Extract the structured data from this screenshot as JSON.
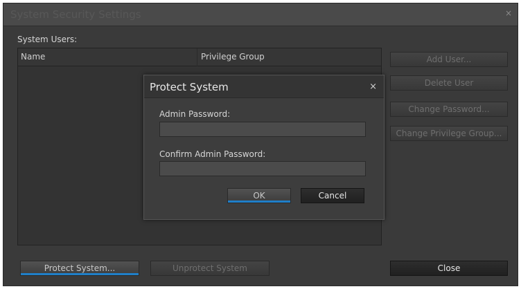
{
  "window": {
    "title": "System Security Settings",
    "close_glyph": "×"
  },
  "users_section": {
    "label": "System Users:",
    "columns": [
      "Name",
      "Privilege Group"
    ],
    "rows": []
  },
  "side_buttons": {
    "add_user": "Add User...",
    "delete_user": "Delete User",
    "change_password": "Change Password...",
    "change_privilege_group": "Change Privilege Group..."
  },
  "bottom_buttons": {
    "protect_system": "Protect System...",
    "unprotect_system": "Unprotect System",
    "close": "Close"
  },
  "dialog": {
    "title": "Protect System",
    "close_glyph": "×",
    "admin_password_label": "Admin Password:",
    "admin_password_value": "",
    "confirm_password_label": "Confirm Admin Password:",
    "confirm_password_value": "",
    "ok": "OK",
    "cancel": "Cancel"
  },
  "colors": {
    "window_bg": "#3a3a3a",
    "accent_glow": "#1f7fc8"
  }
}
